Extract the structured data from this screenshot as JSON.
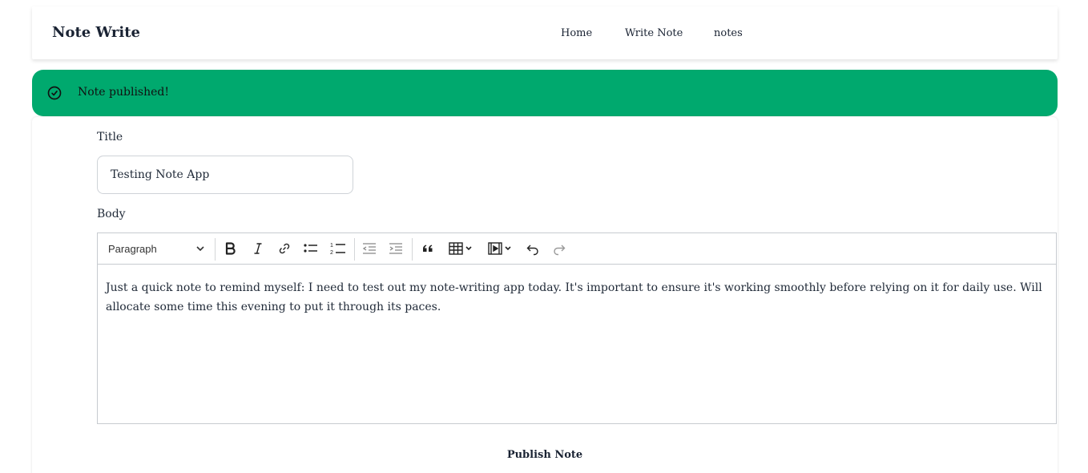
{
  "nav": {
    "brand": "Note Write",
    "links": [
      "Home",
      "Write Note",
      "notes"
    ]
  },
  "alert": {
    "message": "Note published!",
    "icon": "check-circle-icon",
    "color": "#00a96e"
  },
  "form": {
    "title_label": "Title",
    "title_value": "Testing Note App",
    "body_label": "Body",
    "body_text": "Just a quick note to remind myself: I need to test out my note-writing app today. It's important to ensure it's working smoothly before relying on it for daily use. Will allocate some time this evening to put it through its paces.",
    "publish_label": "Publish Note"
  },
  "toolbar": {
    "heading_select": "Paragraph",
    "buttons": [
      "bold-icon",
      "italic-icon",
      "link-icon",
      "bulleted-list-icon",
      "numbered-list-icon",
      "outdent-icon",
      "indent-icon",
      "blockquote-icon",
      "table-icon",
      "media-icon",
      "undo-icon",
      "redo-icon"
    ]
  }
}
